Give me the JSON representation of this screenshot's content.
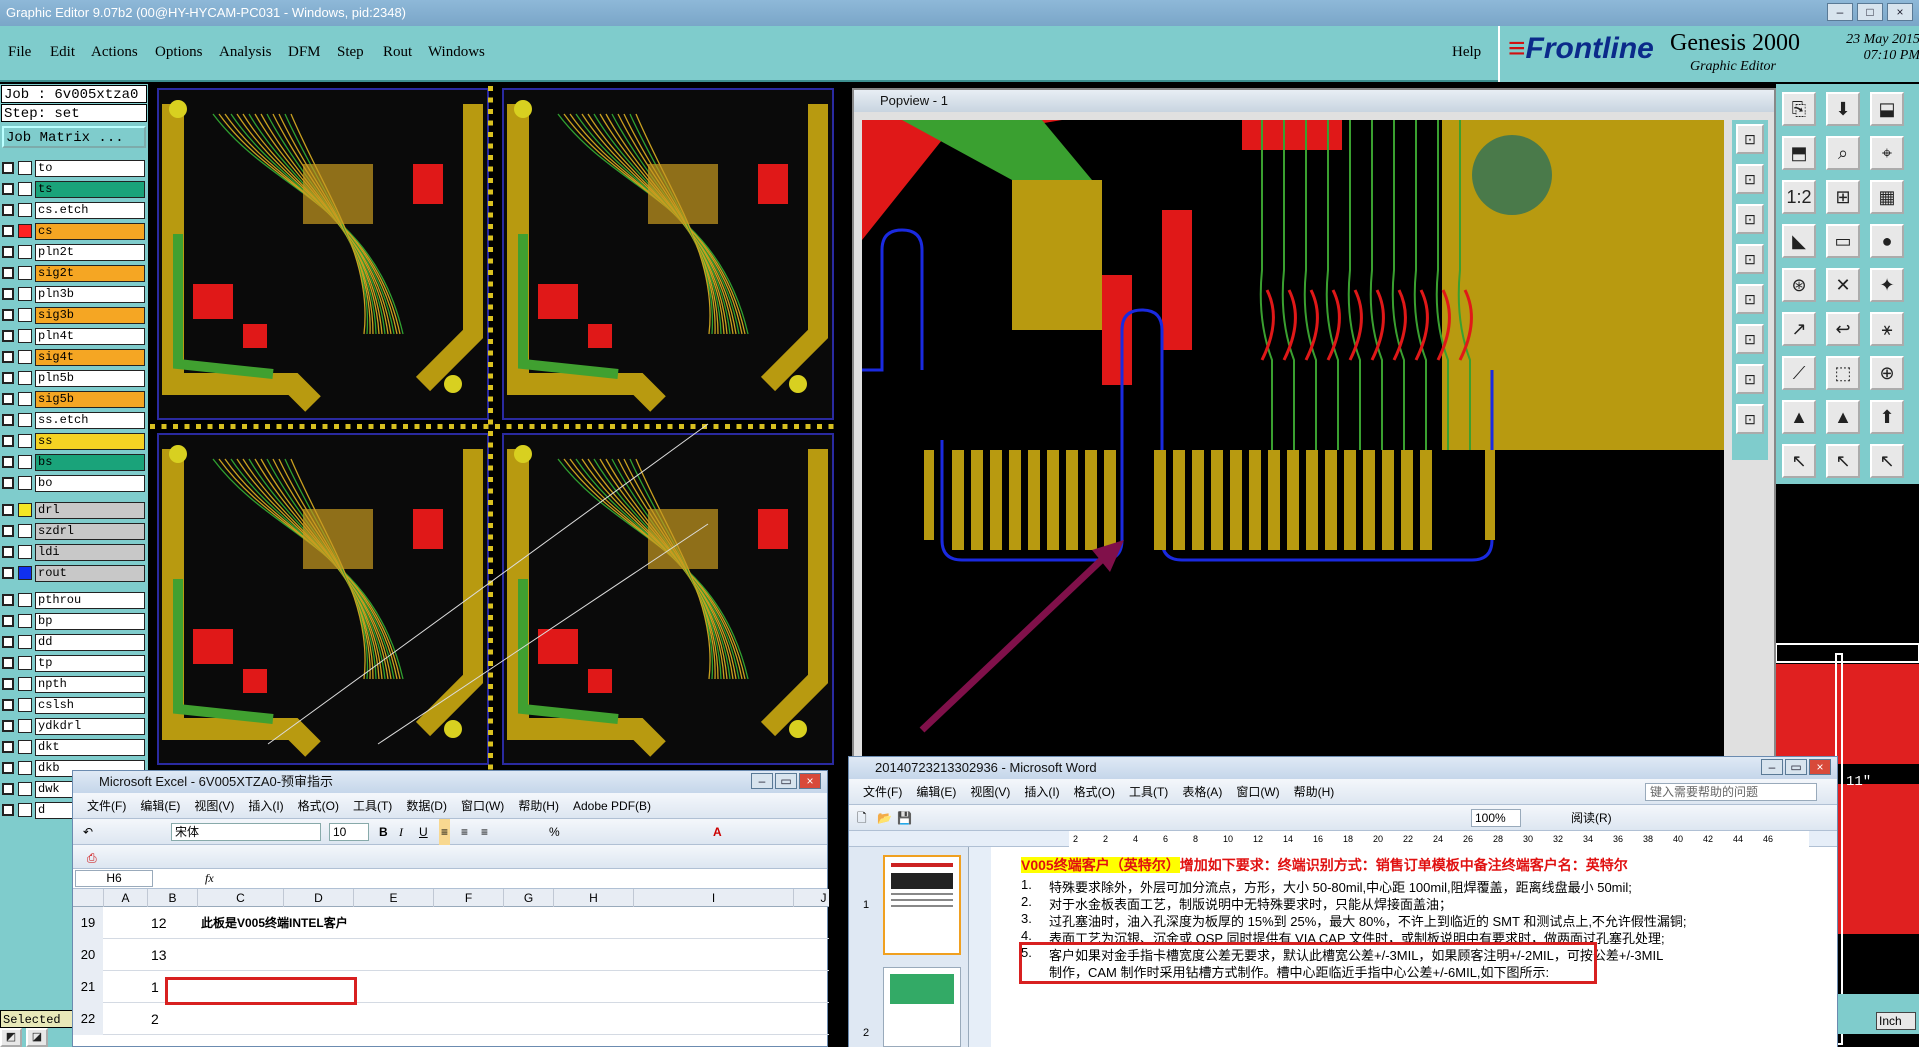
{
  "window": {
    "title": "Graphic Editor 9.07b2 (00@HY-HYCAM-PC031 - Windows, pid:2348)"
  },
  "menu": [
    "File",
    "Edit",
    "Actions",
    "Options",
    "Analysis",
    "DFM",
    "Step",
    "Rout",
    "Windows"
  ],
  "help_label": "Help",
  "brand": {
    "logo": "Frontline",
    "product": "Genesis 2000",
    "subtitle": "Graphic Editor",
    "date": "23 May 2015",
    "time": "07:10 PM"
  },
  "job": {
    "job_line": "Job : 6v005xtza0",
    "step_line": "Step: set",
    "matrix_button": "Job Matrix ..."
  },
  "layers": [
    {
      "name": "to",
      "color": "#ffffff",
      "bg": "#ffffff",
      "chk": false
    },
    {
      "name": "ts",
      "color": "#ffffff",
      "bg": "#1aa37a",
      "chk": false
    },
    {
      "name": "cs.etch",
      "color": "#ffffff",
      "bg": "#ffffff",
      "chk": false
    },
    {
      "name": "cs",
      "color": "#ff2020",
      "bg": "#f5a623",
      "chk": true
    },
    {
      "name": "pln2t",
      "color": "#ffffff",
      "bg": "#ffffff",
      "chk": false
    },
    {
      "name": "sig2t",
      "color": "#ffffff",
      "bg": "#f5a623",
      "chk": false
    },
    {
      "name": "pln3b",
      "color": "#ffffff",
      "bg": "#ffffff",
      "chk": false
    },
    {
      "name": "sig3b",
      "color": "#ffffff",
      "bg": "#f5a623",
      "chk": false
    },
    {
      "name": "pln4t",
      "color": "#ffffff",
      "bg": "#ffffff",
      "chk": false
    },
    {
      "name": "sig4t",
      "color": "#ffffff",
      "bg": "#f5a623",
      "chk": false
    },
    {
      "name": "pln5b",
      "color": "#ffffff",
      "bg": "#ffffff",
      "chk": false
    },
    {
      "name": "sig5b",
      "color": "#ffffff",
      "bg": "#f5a623",
      "chk": false
    },
    {
      "name": "ss.etch",
      "color": "#ffffff",
      "bg": "#ffffff",
      "chk": false
    },
    {
      "name": "ss",
      "color": "#ffffff",
      "bg": "#f5d223",
      "chk": false
    },
    {
      "name": "bs",
      "color": "#ffffff",
      "bg": "#1aa37a",
      "chk": false
    },
    {
      "name": "bo",
      "color": "#ffffff",
      "bg": "#ffffff",
      "chk": false
    },
    {
      "name": "drl",
      "color": "#f5e623",
      "bg": "#c8c8c8",
      "chk": false
    },
    {
      "name": "szdrl",
      "color": "#ffffff",
      "bg": "#c8c8c8",
      "chk": false
    },
    {
      "name": "ldi",
      "color": "#ffffff",
      "bg": "#c8c8c8",
      "chk": false
    },
    {
      "name": "rout",
      "color": "#1030f0",
      "bg": "#c8c8c8",
      "chk": false
    },
    {
      "name": "pthrou",
      "color": "#ffffff",
      "bg": "#ffffff",
      "chk": false
    },
    {
      "name": "bp",
      "color": "#ffffff",
      "bg": "#ffffff",
      "chk": false
    },
    {
      "name": "dd",
      "color": "#ffffff",
      "bg": "#ffffff",
      "chk": false
    },
    {
      "name": "tp",
      "color": "#ffffff",
      "bg": "#ffffff",
      "chk": false
    },
    {
      "name": "npth",
      "color": "#ffffff",
      "bg": "#ffffff",
      "chk": false
    },
    {
      "name": "cslsh",
      "color": "#ffffff",
      "bg": "#ffffff",
      "chk": false
    },
    {
      "name": "ydkdrl",
      "color": "#ffffff",
      "bg": "#ffffff",
      "chk": false
    },
    {
      "name": "dkt",
      "color": "#ffffff",
      "bg": "#ffffff",
      "chk": false
    },
    {
      "name": "dkb",
      "color": "#ffffff",
      "bg": "#ffffff",
      "chk": false
    },
    {
      "name": "dwk",
      "color": "#ffffff",
      "bg": "#ffffff",
      "chk": false
    },
    {
      "name": "d",
      "color": "#ffffff",
      "bg": "#ffffff",
      "chk": false
    }
  ],
  "selected_label": "Selected :",
  "popview": {
    "title": "Popview - 1"
  },
  "right_panel": {
    "unit": "Inch",
    "coord": "11\""
  },
  "excel": {
    "title": "Microsoft Excel - 6V005XTZA0-预审指示",
    "menu": [
      "文件(F)",
      "编辑(E)",
      "视图(V)",
      "插入(I)",
      "格式(O)",
      "工具(T)",
      "数据(D)",
      "窗口(W)",
      "帮助(H)",
      "Adobe PDF(B)"
    ],
    "font": "宋体",
    "size": "10",
    "zoom": "%",
    "name_box": "H6",
    "fx": "fx",
    "columns": [
      "A",
      "B",
      "C",
      "D",
      "E",
      "F",
      "G",
      "H",
      "I",
      "J"
    ],
    "rows": [
      {
        "num": "19",
        "b": "12",
        "c": "此板是V005终端INTEL客户"
      },
      {
        "num": "20",
        "b": "13",
        "c": ""
      },
      {
        "num": "21",
        "b": "1",
        "c": ""
      },
      {
        "num": "22",
        "b": "2",
        "c": ""
      }
    ]
  },
  "word": {
    "title": "20140723213302936 - Microsoft Word",
    "menu": [
      "文件(F)",
      "编辑(E)",
      "视图(V)",
      "插入(I)",
      "格式(O)",
      "工具(T)",
      "表格(A)",
      "窗口(W)",
      "帮助(H)"
    ],
    "help_placeholder": "键入需要帮助的问题",
    "zoom": "100%",
    "read_label": "阅读(R)",
    "ruler": [
      "2",
      "2",
      "4",
      "6",
      "8",
      "10",
      "12",
      "14",
      "16",
      "18",
      "20",
      "22",
      "24",
      "26",
      "28",
      "30",
      "32",
      "34",
      "36",
      "38",
      "40",
      "42",
      "44",
      "46"
    ],
    "thumb_pages": [
      "1",
      "2"
    ],
    "heading_prefix": "V005终端客户（英特尔）",
    "heading_rest": "增加如下要求：终端识别方式：销售订单模板中备注终端客户名：英特尔",
    "items": [
      {
        "n": "1.",
        "t": "特殊要求除外，外层可加分流点，方形，大小 50-80mil,中心距 100mil,阻焊覆盖，距离线盘最小 50mil;"
      },
      {
        "n": "2.",
        "t": "对于水金板表面工艺，制版说明中无特殊要求时，只能从焊接面盖油；"
      },
      {
        "n": "3.",
        "t": "过孔塞油时，油入孔深度为板厚的 15%到 25%，最大 80%，不许上到临近的 SMT 和测试点上,不允许假性漏铜;"
      },
      {
        "n": "4.",
        "t": "表面工艺为沉银、沉金或 OSP 同时提供有 VIA CAP 文件时，或制板说明中有要求时，做两面过孔塞孔处理;"
      },
      {
        "n": "5.",
        "t": "客户如果对金手指卡槽宽度公差无要求，默认此槽宽公差+/-3MIL，如果顾客注明+/-2MIL，可按公差+/-3MIL"
      },
      {
        "n": "",
        "t": "制作，CAM 制作时采用钻槽方式制作。槽中心距临近手指中心公差+/-6MIL,如下图所示:"
      }
    ]
  }
}
